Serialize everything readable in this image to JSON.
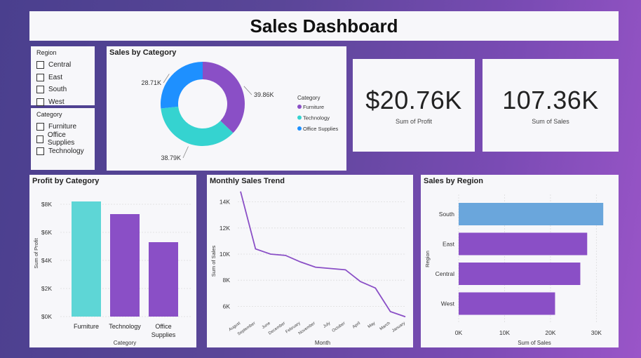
{
  "header": {
    "title": "Sales Dashboard"
  },
  "region_slicer": {
    "title": "Region",
    "items": [
      "Central",
      "East",
      "South",
      "West"
    ]
  },
  "category_slicer": {
    "title": "Category",
    "items": [
      "Furniture",
      "Office Supplies",
      "Technology"
    ]
  },
  "kpis": {
    "profit": {
      "value": "$20.76K",
      "label": "Sum of  Profit"
    },
    "sales": {
      "value": "107.36K",
      "label": "Sum of Sales"
    }
  },
  "colors": {
    "purple": "#8a4fc6",
    "teal": "#5ed6d6",
    "blue": "#1e90ff",
    "region_highlight": "#6aa6dc",
    "line": "#8a4fc6"
  },
  "chart_data": [
    {
      "id": "sales_by_category",
      "type": "pie",
      "title": "Sales by Category",
      "legend_title": "Category",
      "legend_placement": "right",
      "categories": [
        "Furniture",
        "Technology",
        "Office Supplies"
      ],
      "values": [
        39.86,
        38.79,
        28.71
      ],
      "labels": [
        "39.86K",
        "38.79K",
        "28.71K"
      ],
      "colors": [
        "#8a4fc6",
        "#35d3d0",
        "#1e90ff"
      ]
    },
    {
      "id": "profit_by_category",
      "type": "bar",
      "title": "Profit by Category",
      "xlabel": "Category",
      "ylabel": "Sum of Profit",
      "categories": [
        "Furniture",
        "Technology",
        "Office Supplies"
      ],
      "values": [
        8200,
        7300,
        5300
      ],
      "colors": [
        "#5ed6d6",
        "#8a4fc6",
        "#8a4fc6"
      ],
      "ylim": [
        0,
        9000
      ],
      "ticks": [
        0,
        2000,
        4000,
        6000,
        8000
      ],
      "tick_labels": [
        "$0K",
        "$2K",
        "$4K",
        "$6K",
        "$8K"
      ]
    },
    {
      "id": "monthly_sales_trend",
      "type": "line",
      "title": "Monthly Sales Trend",
      "xlabel": "Month",
      "ylabel": "Sum of Sales",
      "categories": [
        "August",
        "September",
        "June",
        "December",
        "February",
        "November",
        "July",
        "October",
        "April",
        "May",
        "March",
        "January"
      ],
      "values": [
        14800,
        10400,
        10000,
        9900,
        9400,
        9000,
        8900,
        8800,
        7900,
        7400,
        5600,
        5200
      ],
      "ylim": [
        5000,
        15000
      ],
      "ticks": [
        6000,
        8000,
        10000,
        12000,
        14000
      ],
      "tick_labels": [
        "6K",
        "8K",
        "10K",
        "12K",
        "14K"
      ],
      "grid": true
    },
    {
      "id": "sales_by_region",
      "type": "bar",
      "orientation": "horizontal",
      "title": "Sales by Region",
      "xlabel": "Sum of Sales",
      "ylabel": "Region",
      "categories": [
        "South",
        "East",
        "Central",
        "West"
      ],
      "values": [
        31500,
        28000,
        26500,
        21000
      ],
      "colors": [
        "#6aa6dc",
        "#8a4fc6",
        "#8a4fc6",
        "#8a4fc6"
      ],
      "xlim": [
        0,
        33000
      ],
      "ticks": [
        0,
        10000,
        20000,
        30000
      ],
      "tick_labels": [
        "0K",
        "10K",
        "20K",
        "30K"
      ]
    }
  ]
}
